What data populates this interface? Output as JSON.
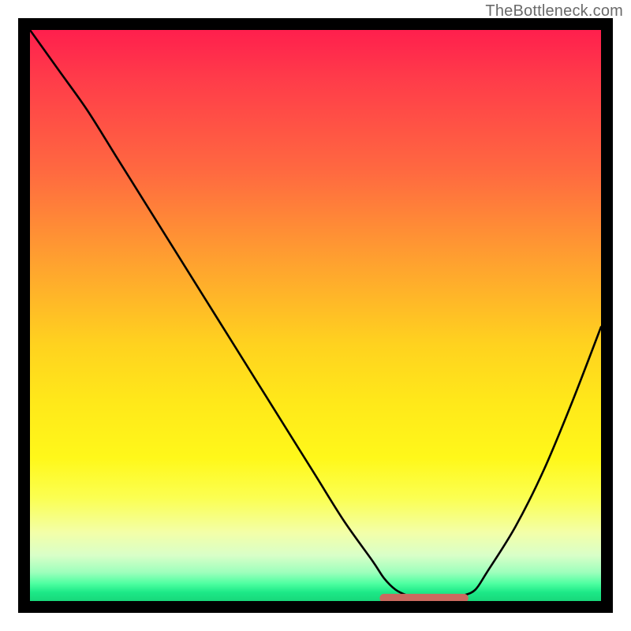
{
  "watermark": "TheBottleneck.com",
  "colors": {
    "frame": "#000000",
    "curve": "#000000",
    "marker": "#cb6a5f",
    "gradient_stops": [
      "#ff1f4d",
      "#ff3a4a",
      "#ff6a40",
      "#ff9f30",
      "#ffd21f",
      "#ffe81a",
      "#fff81a",
      "#fbff52",
      "#f3ffa8",
      "#d9ffc8",
      "#9dffbc",
      "#4cffa0",
      "#1ce887",
      "#18d87a"
    ]
  },
  "chart_data": {
    "type": "line",
    "title": "",
    "xlabel": "",
    "ylabel": "",
    "xlim": [
      0,
      100
    ],
    "ylim": [
      0,
      100
    ],
    "grid": false,
    "legend": false,
    "series": [
      {
        "name": "bottleneck-curve",
        "x": [
          0,
          5,
          10,
          15,
          20,
          25,
          30,
          35,
          40,
          45,
          50,
          55,
          60,
          62,
          64,
          66,
          68,
          70,
          72,
          74,
          76,
          78,
          80,
          85,
          90,
          95,
          100
        ],
        "values": [
          100,
          93,
          86,
          78,
          70,
          62,
          54,
          46,
          38,
          30,
          22,
          14,
          7,
          4,
          2,
          1,
          0.5,
          0.5,
          0.5,
          0.5,
          1,
          2,
          5,
          13,
          23,
          35,
          48
        ]
      }
    ],
    "annotations": [
      {
        "name": "optimal-range-marker",
        "shape": "flat-segment",
        "x_range": [
          62,
          76
        ],
        "y": 0.5,
        "color": "#cb6a5f"
      }
    ]
  }
}
